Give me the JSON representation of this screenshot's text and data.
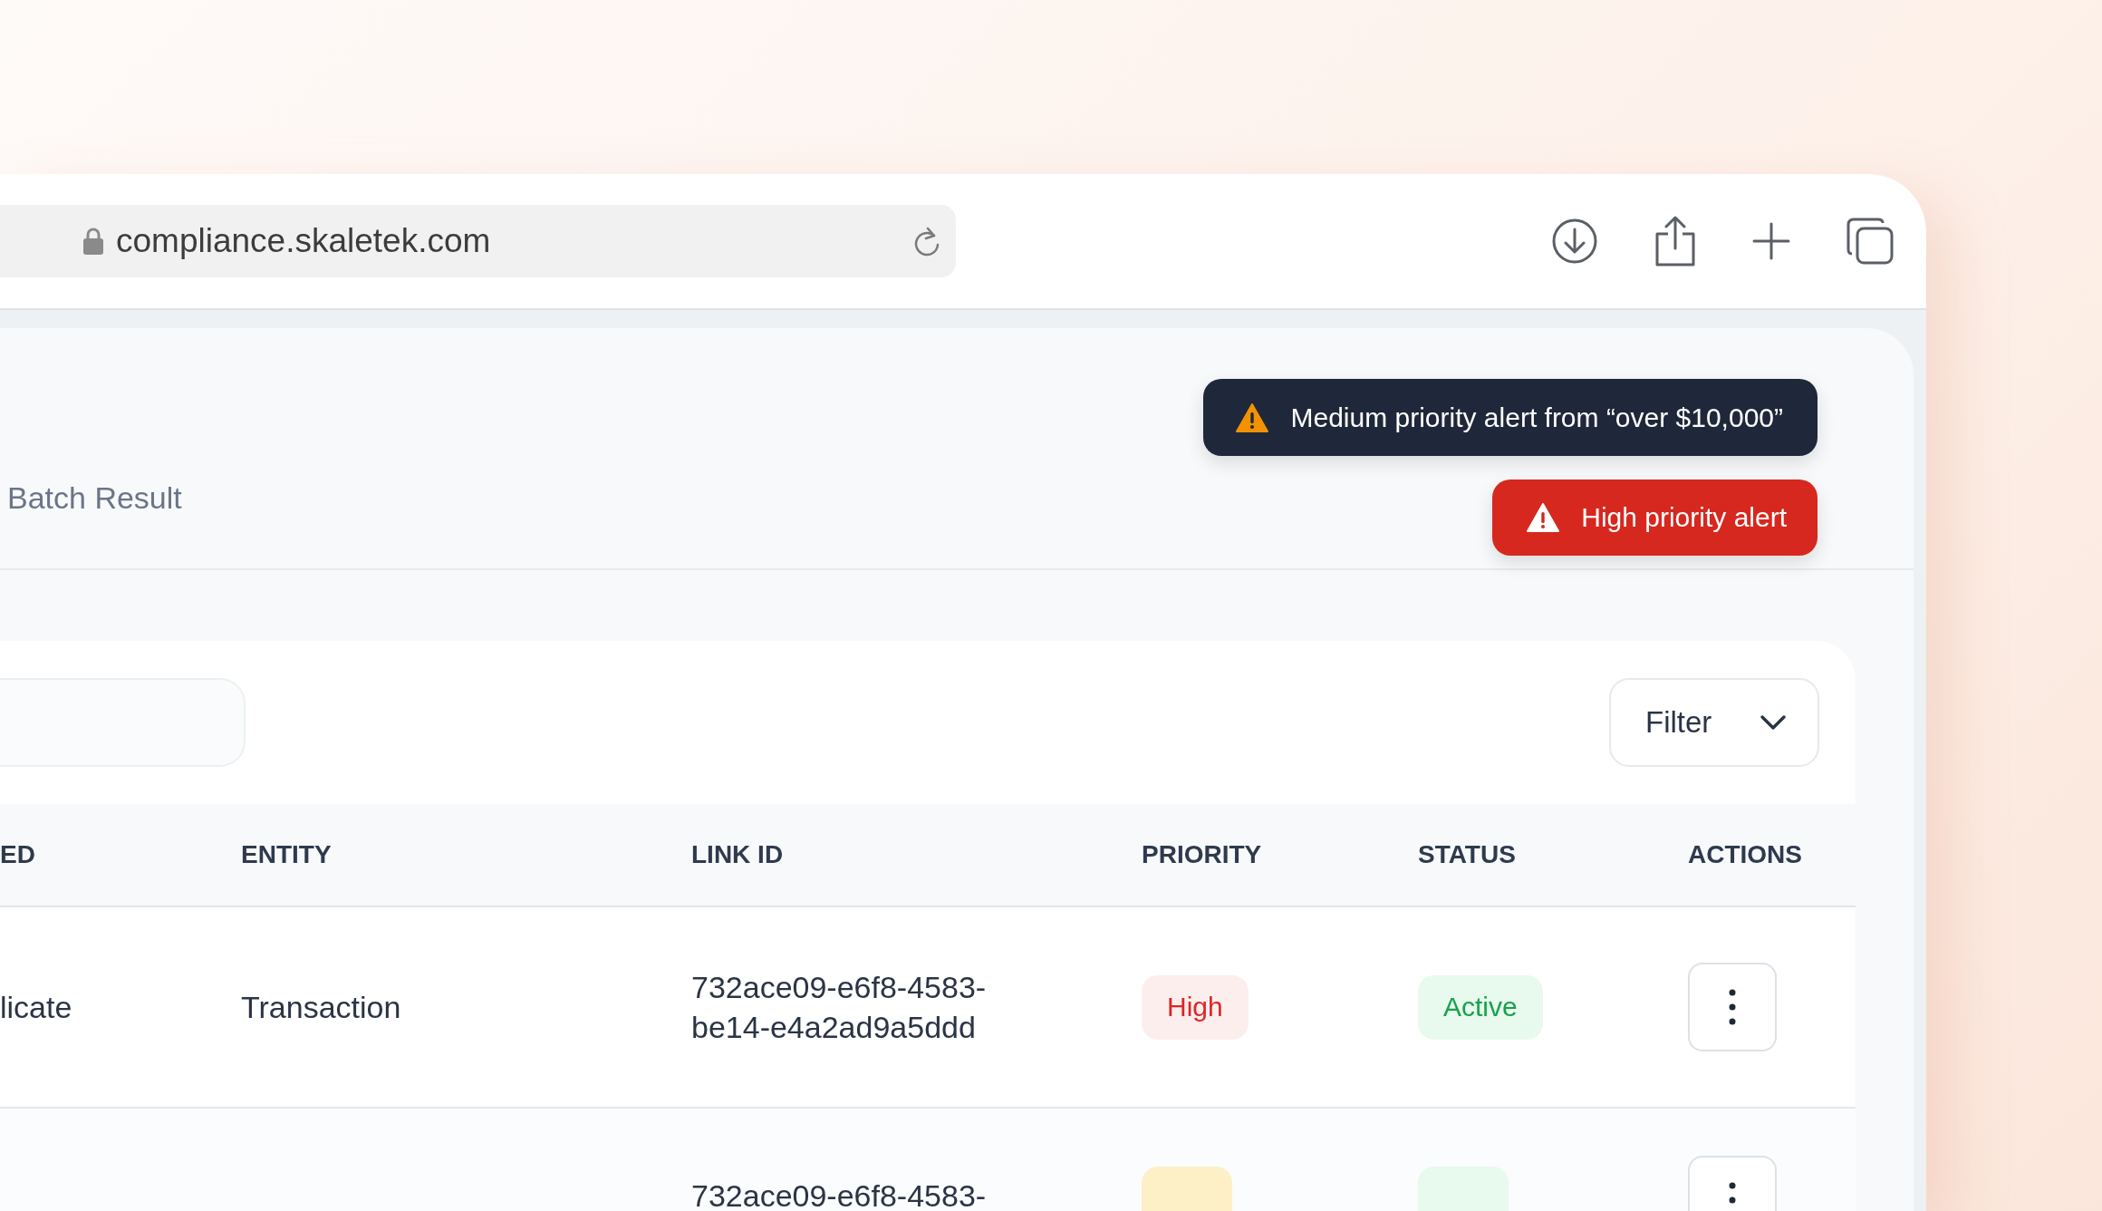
{
  "browser": {
    "url": "compliance.skaletek.com"
  },
  "page": {
    "title": "Batch Result"
  },
  "alerts": [
    {
      "kind": "medium",
      "text": "Medium priority alert from “over $10,000”"
    },
    {
      "kind": "high",
      "text": "High priority alert"
    }
  ],
  "filter": {
    "label": "Filter"
  },
  "table": {
    "columns": [
      "ED",
      "ENTITY",
      "LINK ID",
      "PRIORITY",
      "STATUS",
      "ACTIONS"
    ],
    "rows": [
      {
        "column_1": "licate",
        "entity": "Transaction",
        "link_id": "732ace09-e6f8-4583-be14-e4a2ad9a5ddd",
        "priority": {
          "kind": "high",
          "text": "High"
        },
        "status": {
          "kind": "active",
          "text": "Active"
        }
      },
      {
        "link_id": "732ace09-e6f8-4583-",
        "priority": {
          "kind": "medium"
        },
        "status": {
          "kind": "active"
        }
      }
    ]
  }
}
